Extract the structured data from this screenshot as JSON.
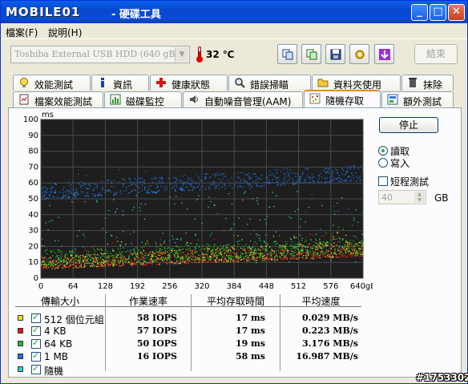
{
  "window": {
    "logo": "MOBILE01",
    "title": "- 硬碟工具"
  },
  "menu": {
    "file": "檔案(F)",
    "help": "說明(H)"
  },
  "toolbar": {
    "device": "Toshiba External USB HDD (640 gB)",
    "temperature": "32 ℃",
    "exit_label": "結束"
  },
  "tabs_row1": [
    {
      "label": "效能測試",
      "icon": "lightbulb-icon"
    },
    {
      "label": "資訊",
      "icon": "info-icon"
    },
    {
      "label": "健康狀態",
      "icon": "red-cross-icon"
    },
    {
      "label": "錯誤掃瞄",
      "icon": "magnifier-icon"
    },
    {
      "label": "資料夾使用",
      "icon": "folder-icon"
    },
    {
      "label": "抹除",
      "icon": "trash-icon"
    }
  ],
  "tabs_row2": [
    {
      "label": "檔案效能測試",
      "icon": "file-benchmark-icon"
    },
    {
      "label": "磁碟監控",
      "icon": "monitor-chart-icon"
    },
    {
      "label": "自動噪音管理(AAM)",
      "icon": "speaker-icon"
    },
    {
      "label": "隨機存取",
      "icon": "random-access-icon"
    },
    {
      "label": "額外測試",
      "icon": "extra-tests-icon"
    }
  ],
  "controls": {
    "stop_label": "停止",
    "read_label": "讀取",
    "write_label": "寫入",
    "short_test_label": "短程測試",
    "short_test_value": "40",
    "gb_label": "GB",
    "read_selected": true
  },
  "chart_data": {
    "type": "scatter",
    "ylabel": "ms",
    "xlabel": "",
    "ylim": [
      0,
      100
    ],
    "xlim": [
      0,
      640
    ],
    "yticks": [
      "0",
      "10",
      "20",
      "30",
      "40",
      "50",
      "60",
      "70",
      "80",
      "90",
      "100"
    ],
    "xticks": [
      "0",
      "64",
      "128",
      "192",
      "256",
      "320",
      "384",
      "448",
      "512",
      "576",
      "640gB"
    ],
    "grid": true,
    "background": "#1E1E1E",
    "series": [
      {
        "name": "512 個位元組",
        "color": "#E8E020",
        "band": [
          6,
          14
        ],
        "band_end": [
          14,
          24
        ]
      },
      {
        "name": "4 KB",
        "color": "#D81818",
        "band": [
          6,
          14
        ],
        "band_end": [
          14,
          22
        ]
      },
      {
        "name": "64 KB",
        "color": "#20C020",
        "band": [
          8,
          18
        ],
        "band_end": [
          16,
          26
        ]
      },
      {
        "name": "1 MB",
        "color": "#2070E0",
        "band": [
          50,
          60
        ],
        "band_end": [
          62,
          72
        ]
      },
      {
        "name": "隨機",
        "color": "#30D0D0",
        "band": [
          10,
          55
        ],
        "band_end": [
          10,
          55
        ]
      }
    ]
  },
  "table": {
    "headers": [
      "傳輸大小",
      "作業速率",
      "平均存取時間",
      "平均速度"
    ],
    "rows": [
      {
        "name": "512 個位元組",
        "color": "#E8E020",
        "checked": true,
        "rate": "58 IOPS",
        "access": "17 ms",
        "speed": "0.029 MB/s"
      },
      {
        "name": "4 KB",
        "color": "#D81818",
        "checked": true,
        "rate": "57 IOPS",
        "access": "17 ms",
        "speed": "0.223 MB/s"
      },
      {
        "name": "64 KB",
        "color": "#20C020",
        "checked": true,
        "rate": "50 IOPS",
        "access": "19 ms",
        "speed": "3.176 MB/s"
      },
      {
        "name": "1 MB",
        "color": "#2070E0",
        "checked": true,
        "rate": "16 IOPS",
        "access": "58 ms",
        "speed": "16.987 MB/s"
      },
      {
        "name": "隨機",
        "color": "#30D0D0",
        "checked": true,
        "rate": "",
        "access": "",
        "speed": ""
      }
    ]
  },
  "watermark": "#1753302"
}
